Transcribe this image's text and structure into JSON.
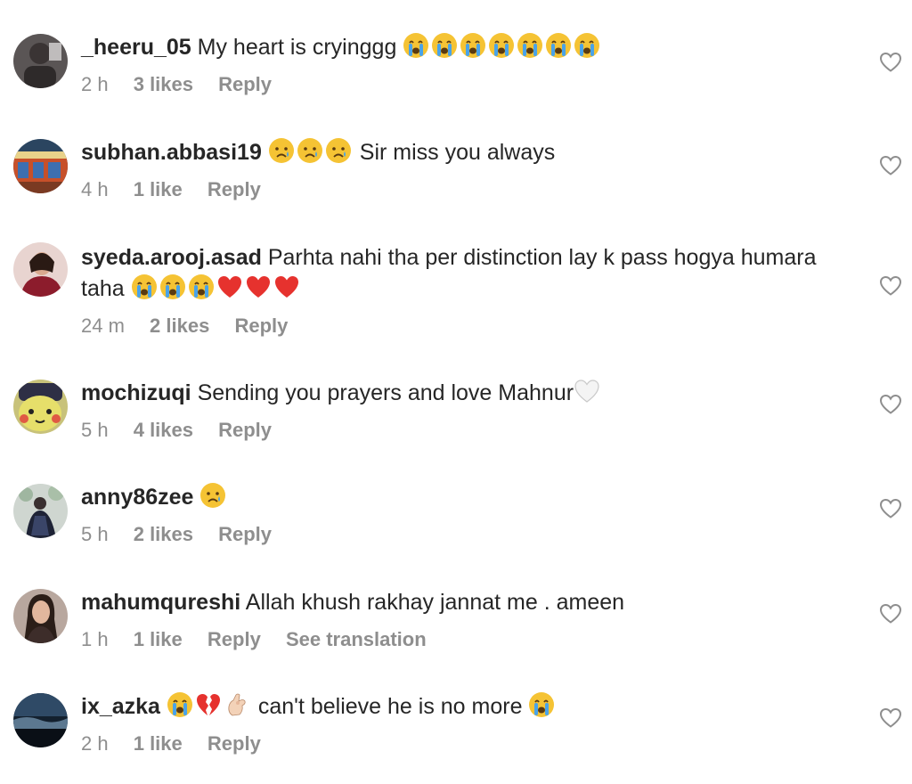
{
  "comments": [
    {
      "username": "_heeru_05",
      "text_before": "My heart is cryinggg",
      "emojis_after": [
        "crying",
        "crying",
        "crying",
        "crying",
        "crying",
        "crying",
        "crying"
      ],
      "time": "2 h",
      "likes": "3 likes",
      "reply": "Reply",
      "translation": "",
      "avatar": "avatar-dark"
    },
    {
      "username": "subhan.abbasi19",
      "emojis_before": [
        "sad-tear",
        "sad-tear",
        "sad-tear"
      ],
      "text_after": "Sir miss you always",
      "time": "4 h",
      "likes": "1 like",
      "reply": "Reply",
      "translation": "",
      "avatar": "avatar-storefront"
    },
    {
      "username": "syeda.arooj.asad",
      "text_before": "Parhta nahi tha per distinction lay k pass hogya humara taha",
      "emojis_after": [
        "crying",
        "crying",
        "crying",
        "red-heart",
        "red-heart",
        "red-heart"
      ],
      "time": "24 m",
      "likes": "2 likes",
      "reply": "Reply",
      "translation": "",
      "avatar": "avatar-person-red"
    },
    {
      "username": "mochizuqi",
      "text_before": "Sending you prayers and love Mahnur",
      "emojis_after": [
        "white-heart"
      ],
      "time": "5 h",
      "likes": "4 likes",
      "reply": "Reply",
      "translation": "",
      "avatar": "avatar-pikachu"
    },
    {
      "username": "anny86zee",
      "emojis_after": [
        "sad-tear"
      ],
      "time": "5 h",
      "likes": "2 likes",
      "reply": "Reply",
      "translation": "",
      "avatar": "avatar-wedding"
    },
    {
      "username": "mahumqureshi",
      "text_before": "Allah khush rakhay jannat me . ameen",
      "time": "1 h",
      "likes": "1 like",
      "reply": "Reply",
      "translation": "See translation",
      "avatar": "avatar-woman"
    },
    {
      "username": "ix_azka",
      "emojis_before": [
        "crying",
        "broken-heart",
        "pinching-hand"
      ],
      "text_after": "can't believe he is no more",
      "emojis_end": [
        "crying"
      ],
      "time": "2 h",
      "likes": "1 like",
      "reply": "Reply",
      "translation": "",
      "avatar": "avatar-night-sky"
    }
  ],
  "colors": {
    "text": "#262626",
    "meta": "#8e8e8e",
    "heart_outline": "#8e8e8e",
    "emoji_yellow": "#f5c334",
    "emoji_red": "#e6322e"
  }
}
